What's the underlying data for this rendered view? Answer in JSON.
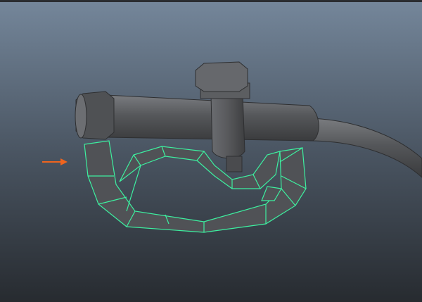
{
  "viewport": {
    "background_top": "#74869a",
    "background_bottom": "#282c31",
    "model_color": "#5a5c5f",
    "wireframe_color": "#3df0a0",
    "selection_arrow_color": "#f0641e"
  },
  "icons": [
    "selection-arrow-icon"
  ]
}
